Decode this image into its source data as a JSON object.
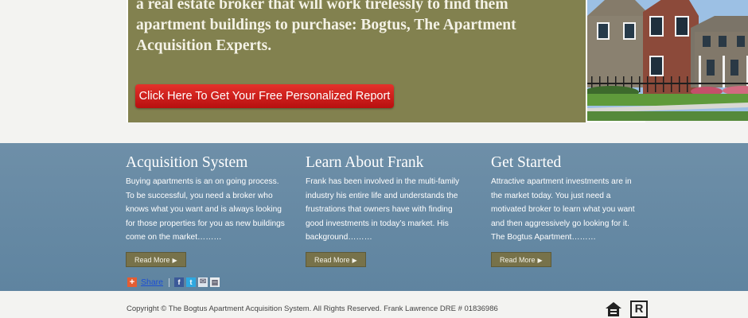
{
  "hero": {
    "text": "a real estate broker that will work tirelessly to find them apartment buildings to purchase: Bogtus, The Apartment Acquisition Experts.",
    "cta_label": "Click Here To Get Your Free Personalized Report",
    "colors": {
      "panel": "#82814f",
      "cta": "#d21f1f"
    }
  },
  "columns": [
    {
      "title": "Acquisition System",
      "body": "Buying apartments is an on going process. To be successful, you need a broker who knows what you want and is always looking for those properties for you as new buildings come on the market………",
      "button": "Read More"
    },
    {
      "title": "Learn About Frank",
      "body": "Frank has been involved in the multi-family industry his entire life and understands the frustrations that owners have with finding good investments in today’s market. His background………",
      "button": "Read More"
    },
    {
      "title": "Get Started",
      "body": "Attractive apartment investments are in the market today. You just need a motivated broker to learn what you want and then aggressively go looking for it. The Bogtus Apartment………",
      "button": "Read More"
    }
  ],
  "share": {
    "label": "Share",
    "icons": [
      "plus-icon",
      "facebook-icon",
      "twitter-icon",
      "email-icon",
      "print-icon"
    ]
  },
  "footer": {
    "copyright": "Copyright © The Bogtus Apartment Acquisition System. All Rights Reserved. Frank Lawrence DRE # 01836986",
    "realtor_mark": "R"
  }
}
